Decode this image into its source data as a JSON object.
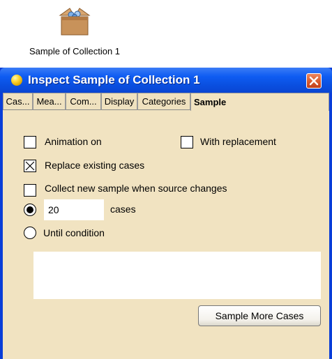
{
  "desktop": {
    "icon": "collection-box-icon",
    "label": "Sample of Collection 1"
  },
  "window": {
    "title": "Inspect Sample of Collection 1",
    "title_icon": "orb-icon",
    "close_icon": "close-icon",
    "colors": {
      "titlebar": "#0a4fe0",
      "panel": "#f1e3c1",
      "close": "#d85a2c"
    }
  },
  "tabs": [
    {
      "label": "Cas..."
    },
    {
      "label": "Mea..."
    },
    {
      "label": "Com..."
    },
    {
      "label": "Display"
    },
    {
      "label": "Categories"
    },
    {
      "label": "Sample",
      "active": true
    }
  ],
  "sample": {
    "animation_label": "Animation on",
    "animation_checked": false,
    "replacement_label": "With replacement",
    "replacement_checked": false,
    "replace_label": "Replace existing cases",
    "replace_checked": true,
    "collect_label": "Collect new sample when source changes",
    "collect_checked": false,
    "count_value": "20",
    "cases_label": "cases",
    "count_selected": true,
    "until_label": "Until condition",
    "until_selected": false,
    "condition_text": "",
    "button_label": "Sample More Cases"
  }
}
